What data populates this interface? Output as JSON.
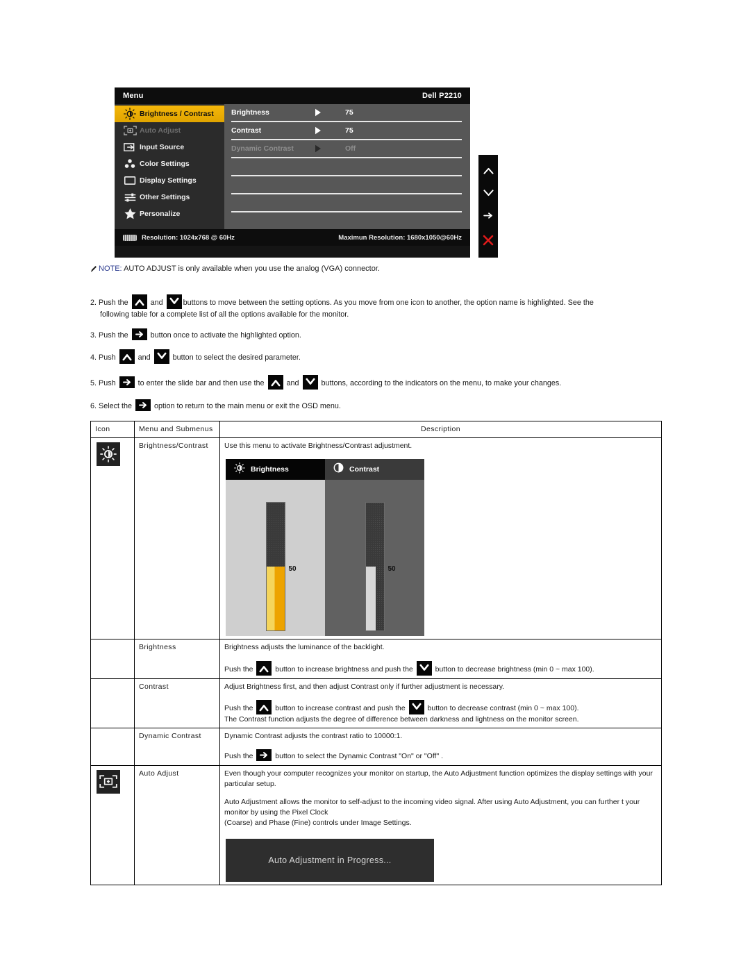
{
  "osd": {
    "title_left": "Menu",
    "title_right": "Dell P2210",
    "sidebar": [
      {
        "label": "Brightness / Contrast",
        "icon": "brightness-icon",
        "state": "active"
      },
      {
        "label": "Auto Adjust",
        "icon": "auto-adjust-icon",
        "state": "disabled"
      },
      {
        "label": "Input Source",
        "icon": "input-source-icon",
        "state": "normal"
      },
      {
        "label": "Color Settings",
        "icon": "color-settings-icon",
        "state": "normal"
      },
      {
        "label": "Display Settings",
        "icon": "display-settings-icon",
        "state": "normal"
      },
      {
        "label": "Other Settings",
        "icon": "other-settings-icon",
        "state": "normal"
      },
      {
        "label": "Personalize",
        "icon": "personalize-icon",
        "state": "normal"
      }
    ],
    "options": [
      {
        "name": "Brightness",
        "value": "75",
        "state": "normal"
      },
      {
        "name": "Contrast",
        "value": "75",
        "state": "normal"
      },
      {
        "name": "Dynamic Contrast",
        "value": "Off",
        "state": "disabled"
      }
    ],
    "footer": {
      "resolution": "Resolution: 1024x768 @ 60Hz",
      "max_resolution": "Maximun Resolution: 1680x1050@60Hz"
    },
    "buttons": [
      "up-arrow-icon",
      "down-arrow-icon",
      "right-arrow-icon",
      "close-x-icon"
    ],
    "colors": {
      "accent": "#f5b70a",
      "close": "#e01b1b",
      "panel": "#575757",
      "sidebar": "#2b2b2b"
    }
  },
  "note": {
    "prefix": "NOTE:",
    "text": " AUTO ADJUST is only available when you use the analog (VGA) connector."
  },
  "steps": {
    "s2_a": "2. Push the ",
    "s2_b": " and ",
    "s2_c": "buttons to move between the setting options. As you move from one icon to another, the option name is highlighted. See the",
    "s2_d": "following table for a complete list of all the options available for the monitor.",
    "s3_a": "3. Push the ",
    "s3_b": " button once to activate the highlighted option.",
    "s4_a": "4. Push ",
    "s4_b": " and ",
    "s4_c": " button to select the desired parameter.",
    "s5_a": "5. Push ",
    "s5_b": " to enter the slide bar and then use the ",
    "s5_c": " and ",
    "s5_d": " buttons, according to the indicators on the menu, to make your changes.",
    "s6_a": "6. Select the ",
    "s6_b": " option to return to the main menu or exit the OSD menu."
  },
  "table": {
    "headers": {
      "icon": "Icon",
      "menu": "Menu and Submenus",
      "description": "Description"
    },
    "rows": {
      "brightness_contrast": {
        "menu": "Brightness/Contrast",
        "icon": "brightness-icon",
        "desc": "Use this menu to activate Brightness/Contrast adjustment.",
        "demo": {
          "left_label": "Brightness",
          "right_label": "Contrast",
          "left_value": "50",
          "right_value": "50"
        }
      },
      "brightness": {
        "menu": "Brightness",
        "p1": "Brightness adjusts the luminance of the backlight.",
        "p2_a": "Push the ",
        "p2_b": " button to increase brightness and push the ",
        "p2_c": " button to decrease brightness (min 0 ~ max 100)."
      },
      "contrast": {
        "menu": "Contrast",
        "p1": "Adjust Brightness first, and then adjust Contrast only if further adjustment is necessary.",
        "p2_a": "Push the ",
        "p2_b": " button to increase contrast and push the ",
        "p2_c": " button to decrease contrast (min 0 ~ max 100).",
        "p3": "The Contrast function adjusts the degree of difference between darkness and lightness on the monitor screen."
      },
      "dynamic_contrast": {
        "menu": "Dynamic Contrast",
        "p1": "Dynamic Contrast adjusts the contrast ratio to 10000:1.",
        "p2_a": "Push the ",
        "p2_b": " button to select the Dynamic Contrast \"On\" or \"Off\" ."
      },
      "auto_adjust": {
        "menu": "Auto Adjust",
        "icon": "auto-adjust-icon",
        "p1": "Even though your computer recognizes your monitor on startup, the Auto Adjustment function optimizes the display settings with your particular setup.",
        "p2": "Auto Adjustment allows the monitor to self-adjust to the incoming video signal. After using Auto Adjustment, you can further t your monitor by using the Pixel Clock",
        "p3": "(Coarse) and Phase (Fine) controls under Image Settings.",
        "progress": "Auto Adjustment  in Progress..."
      }
    }
  }
}
